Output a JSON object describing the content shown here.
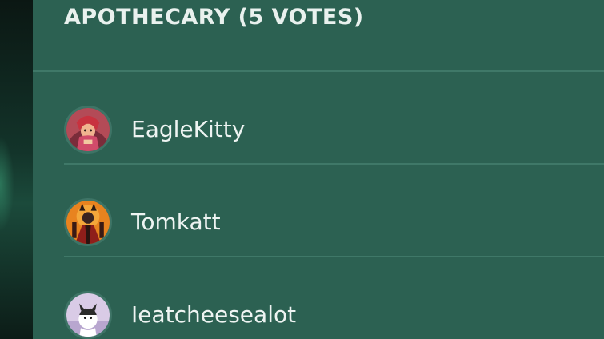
{
  "poll_option": {
    "title": "APOTHECARY (5 VOTES)"
  },
  "voters": [
    {
      "name": "EagleKitty",
      "avatar_icon": "eaglekitty-avatar-icon",
      "avatar_bg": "#b34b57"
    },
    {
      "name": "Tomkatt",
      "avatar_icon": "tomkatt-avatar-icon",
      "avatar_bg": "#e8831f"
    },
    {
      "name": "Ieatcheesealot",
      "avatar_icon": "ieatcheesealot-avatar-icon",
      "avatar_bg": "#d9cbe6"
    }
  ],
  "colors": {
    "panel": "#2c6152",
    "divider": "#3f7868",
    "text": "#eef4f2"
  }
}
